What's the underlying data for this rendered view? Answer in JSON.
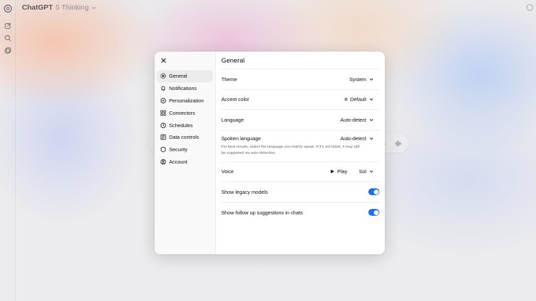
{
  "app": {
    "title": "ChatGPT",
    "model": "5 Thinking"
  },
  "settings": {
    "title": "General",
    "nav": [
      {
        "label": "General",
        "icon": "gear-icon",
        "active": true
      },
      {
        "label": "Notifications",
        "icon": "bell-icon",
        "active": false
      },
      {
        "label": "Personalization",
        "icon": "personalization-icon",
        "active": false
      },
      {
        "label": "Connectors",
        "icon": "connectors-icon",
        "active": false
      },
      {
        "label": "Schedules",
        "icon": "clock-icon",
        "active": false
      },
      {
        "label": "Data controls",
        "icon": "data-controls-icon",
        "active": false
      },
      {
        "label": "Security",
        "icon": "shield-icon",
        "active": false
      },
      {
        "label": "Account",
        "icon": "account-icon",
        "active": false
      }
    ],
    "theme": {
      "label": "Theme",
      "value": "System"
    },
    "accent": {
      "label": "Accent color",
      "value": "Default",
      "color": "#9a9aa0"
    },
    "language": {
      "label": "Language",
      "value": "Auto-detect"
    },
    "spoken": {
      "label": "Spoken language",
      "value": "Auto-detect",
      "description": "For best results, select the language you mainly speak. If it's not listed, it may still be supported via auto-detection."
    },
    "voice": {
      "label": "Voice",
      "play": "Play",
      "value": "Sol"
    },
    "legacy": {
      "label": "Show legacy models",
      "on": true
    },
    "followup": {
      "label": "Show follow up suggestions in chats",
      "on": true
    }
  },
  "colors": {
    "toggle": "#1d6ff3",
    "active_nav": "#ececec"
  }
}
